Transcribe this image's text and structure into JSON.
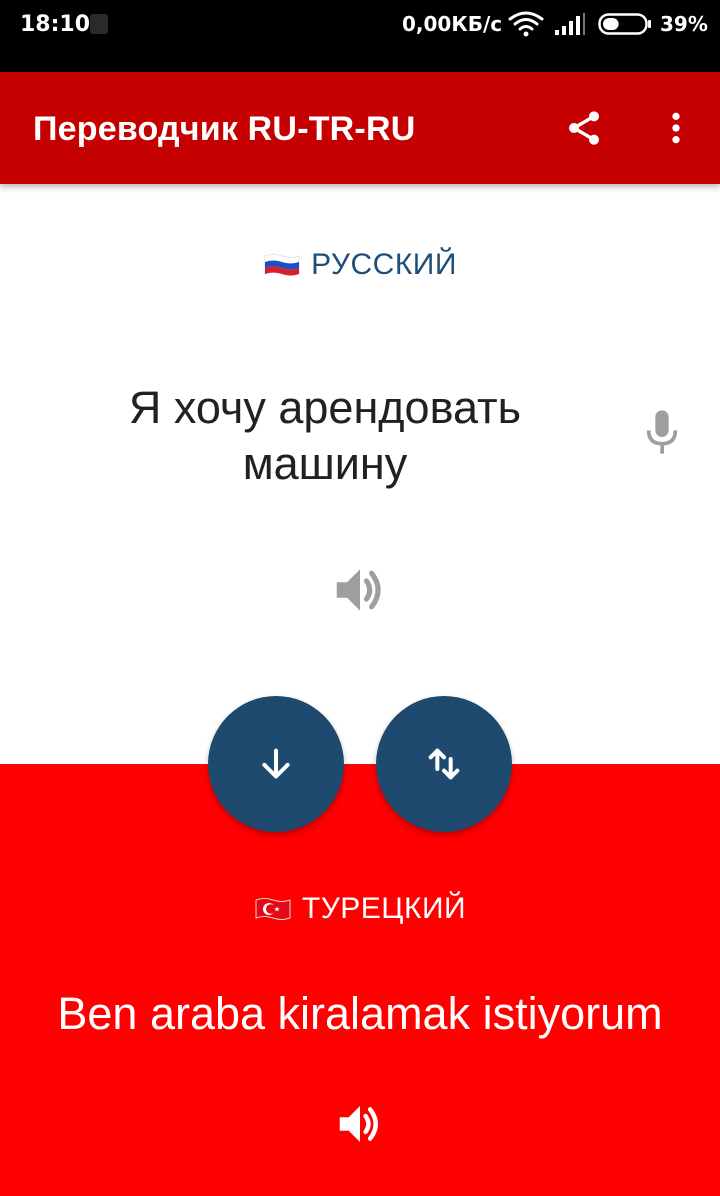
{
  "status_bar": {
    "time": "18:10",
    "network_speed": "0,00КБ/с",
    "battery_percent": "39%",
    "battery_level": 0.39
  },
  "app_bar": {
    "title": "Переводчик RU-TR-RU",
    "share_icon": "share-icon",
    "menu_icon": "more-vert-icon"
  },
  "source": {
    "language": "РУССКИЙ",
    "flag": "russia-flag",
    "text": "Я хочу арендовать машину",
    "mic_icon": "microphone-icon",
    "speaker_icon": "speaker-icon"
  },
  "target": {
    "language": "ТУРЕЦКИЙ",
    "flag": "turkey-flag",
    "text": "Ben araba kiralamak istiyorum",
    "speaker_icon": "speaker-icon"
  },
  "actions": {
    "translate_icon": "arrow-down-icon",
    "swap_icon": "swap-vertical-icon"
  },
  "colors": {
    "status_bar": "#000000",
    "app_bar": "#c50000",
    "target_panel": "#fe0000",
    "fab": "#1d4a6e",
    "source_language_text": "#1f4e79",
    "source_text": "#212121",
    "icon_grey": "#9e9e9e"
  }
}
